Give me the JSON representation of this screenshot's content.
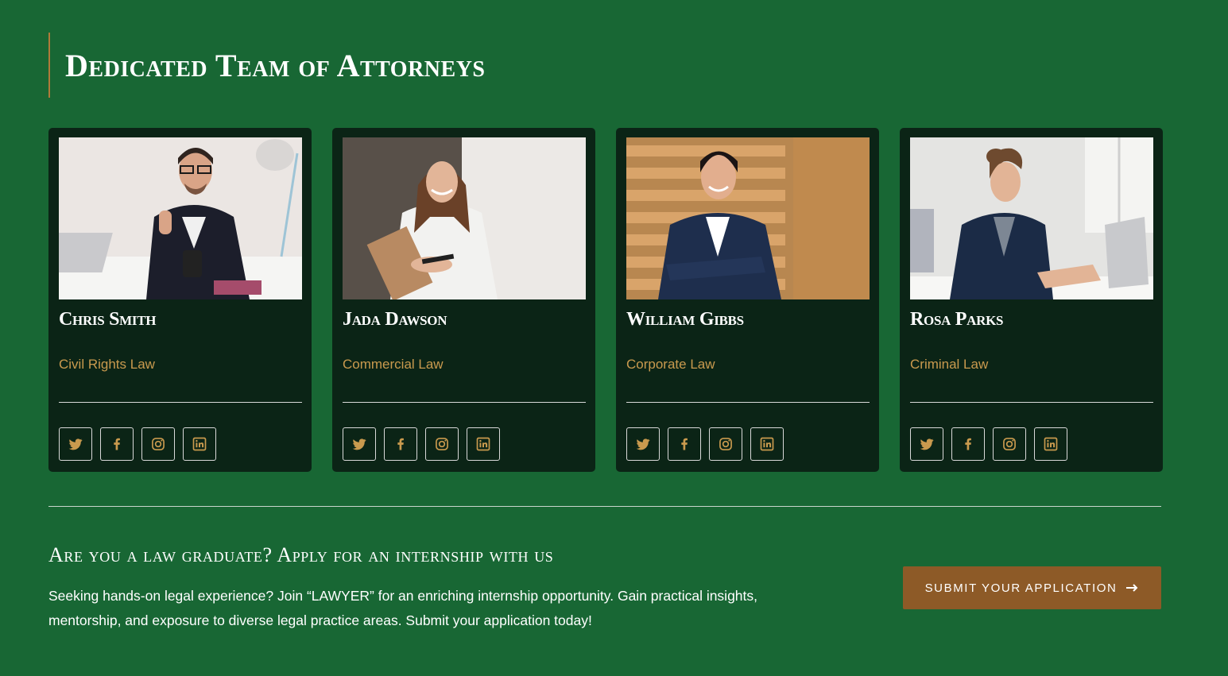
{
  "section": {
    "title": "Dedicated Team of Attorneys"
  },
  "attorneys": [
    {
      "name": "Chris Smith",
      "area": "Civil Rights Law"
    },
    {
      "name": "Jada Dawson",
      "area": "Commercial Law"
    },
    {
      "name": "William Gibbs",
      "area": "Corporate Law"
    },
    {
      "name": "Rosa Parks",
      "area": "Criminal Law"
    }
  ],
  "social_icons": [
    "twitter-icon",
    "facebook-icon",
    "instagram-icon",
    "linkedin-icon"
  ],
  "internship": {
    "title": "Are you a law graduate? Apply for an internship with us",
    "description": "Seeking hands-on legal experience? Join “LAWYER” for an enriching internship opportunity. Gain practical insights, mentorship, and exposure to diverse legal practice areas. Submit your application today!",
    "button_label": "SUBMIT YOUR APPLICATION"
  },
  "colors": {
    "background": "#186734",
    "card": "#0b2416",
    "accent_gold": "#c99a4e",
    "button": "#8d5a27"
  }
}
